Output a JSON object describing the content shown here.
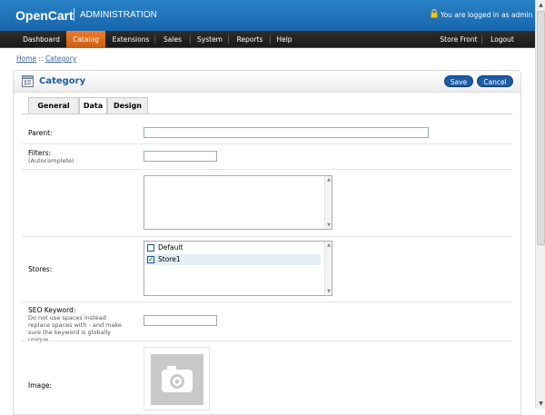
{
  "header": {
    "logo": "OpenCart",
    "subtitle": "ADMINISTRATION",
    "logged_in": "You are logged in as admin",
    "icon": "lock-icon"
  },
  "menu": {
    "left": [
      "Dashboard",
      "Catalog",
      "Extensions",
      "Sales",
      "System",
      "Reports",
      "Help"
    ],
    "right": [
      "Store Front",
      "Logout"
    ],
    "active": "Catalog",
    "active_color": "#e0681a"
  },
  "breadcrumb": {
    "home": "Home",
    "sep": " :: ",
    "current": "Category"
  },
  "page": {
    "title": "Category",
    "save": "Save",
    "cancel": "Cancel",
    "accent": "#1d5da6"
  },
  "tabs": [
    "General",
    "Data",
    "Design"
  ],
  "active_tab": "Data",
  "form": {
    "parent_label": "Parent:",
    "parent_value": "",
    "filters_label": "Filters:",
    "filters_help": "(Autocomplete)",
    "filters_value": "",
    "stores_label": "Stores:",
    "stores": [
      {
        "name": "Default",
        "checked": false
      },
      {
        "name": "Store1",
        "checked": true
      }
    ],
    "seo_label": "SEO Keyword:",
    "seo_help": "Do not use spaces instead replace spaces with - and make sure the keyword is globally unique.",
    "seo_value": "",
    "image_label": "Image:"
  }
}
